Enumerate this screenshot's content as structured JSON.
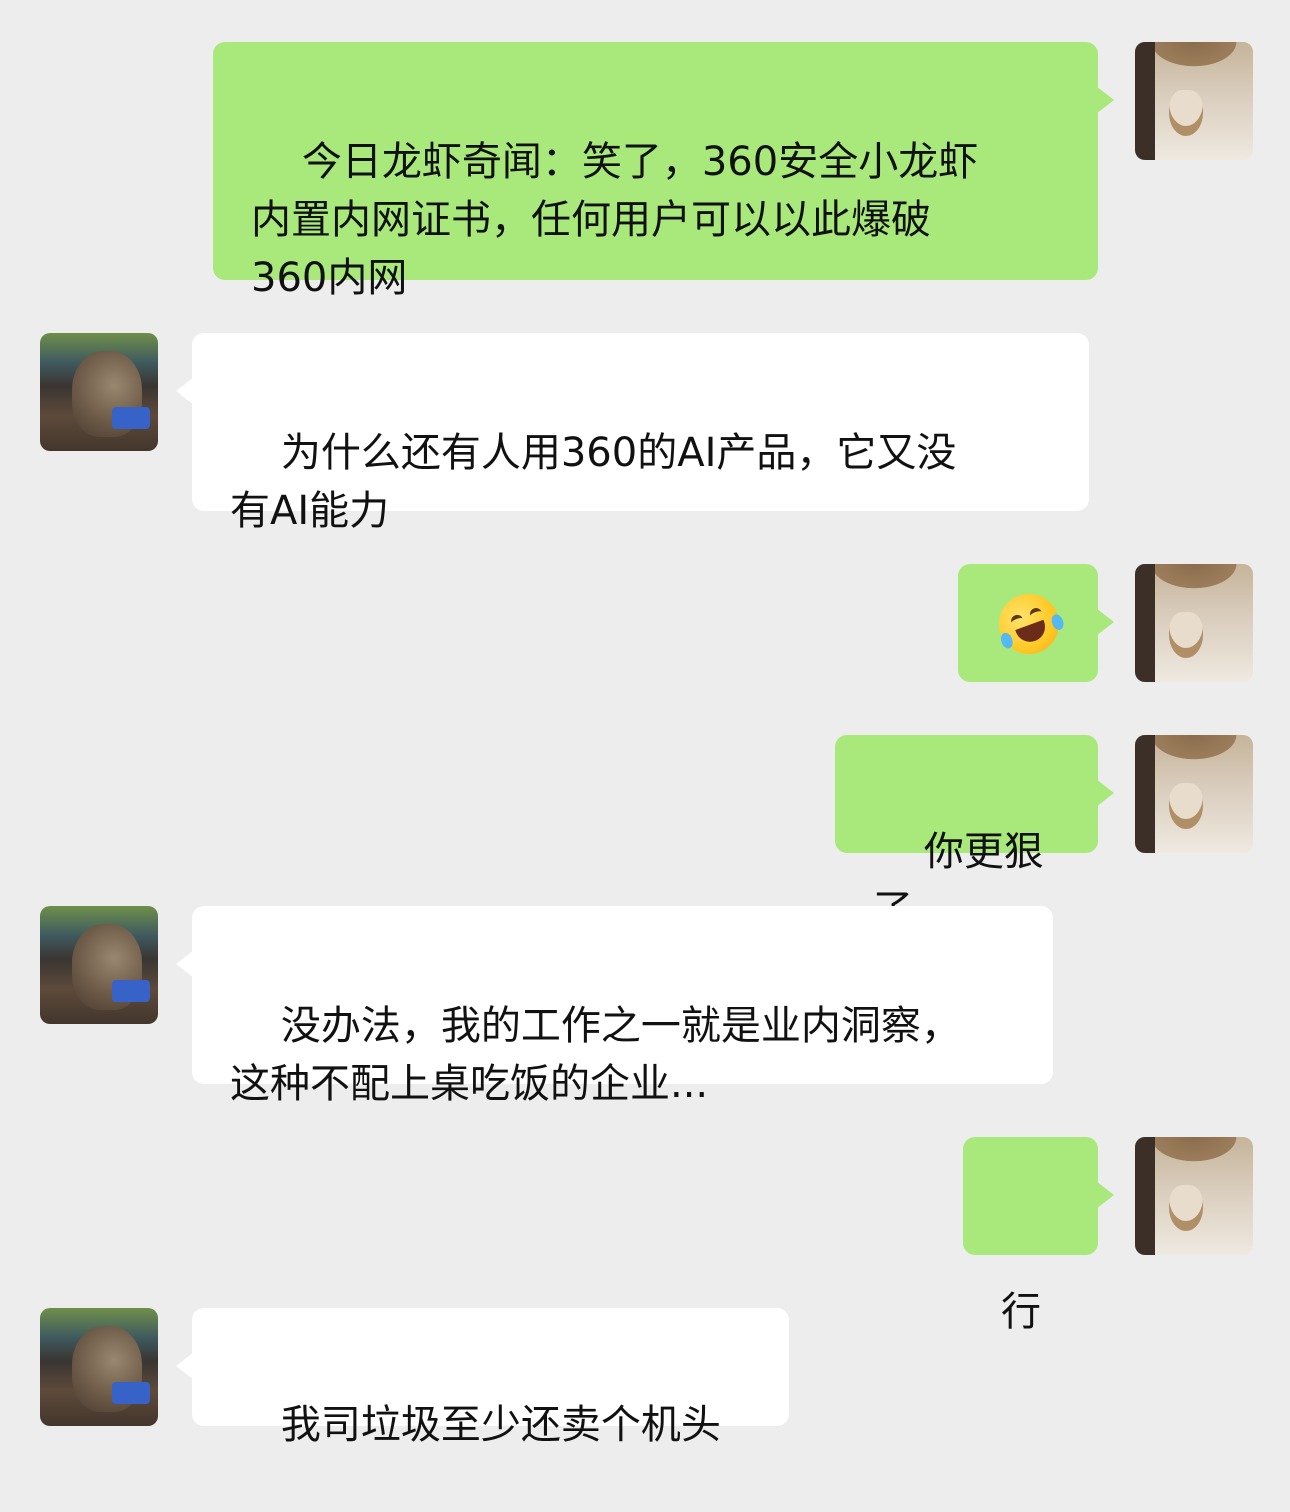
{
  "chat": {
    "messages": [
      {
        "sender": "me",
        "text": "今日龙虾奇闻：笑了，360安全小龙虾\n内置内网证书，任何用户可以以此爆破\n360内网"
      },
      {
        "sender": "other",
        "text": "为什么还有人用360的AI产品，它又没\n有AI能力"
      },
      {
        "sender": "me",
        "emoji": "rolling-on-floor-laughing-emoji"
      },
      {
        "sender": "me",
        "text": "你更狠了"
      },
      {
        "sender": "other",
        "text": "没办法，我的工作之一就是业内洞察，\n这种不配上桌吃饭的企业..."
      },
      {
        "sender": "me",
        "text": "行"
      },
      {
        "sender": "other",
        "text": "我司垃圾至少还卖个机头"
      }
    ]
  },
  "colors": {
    "background": "#ededed",
    "outgoing_bubble": "#a9e97b",
    "incoming_bubble": "#ffffff",
    "text": "#111111"
  }
}
